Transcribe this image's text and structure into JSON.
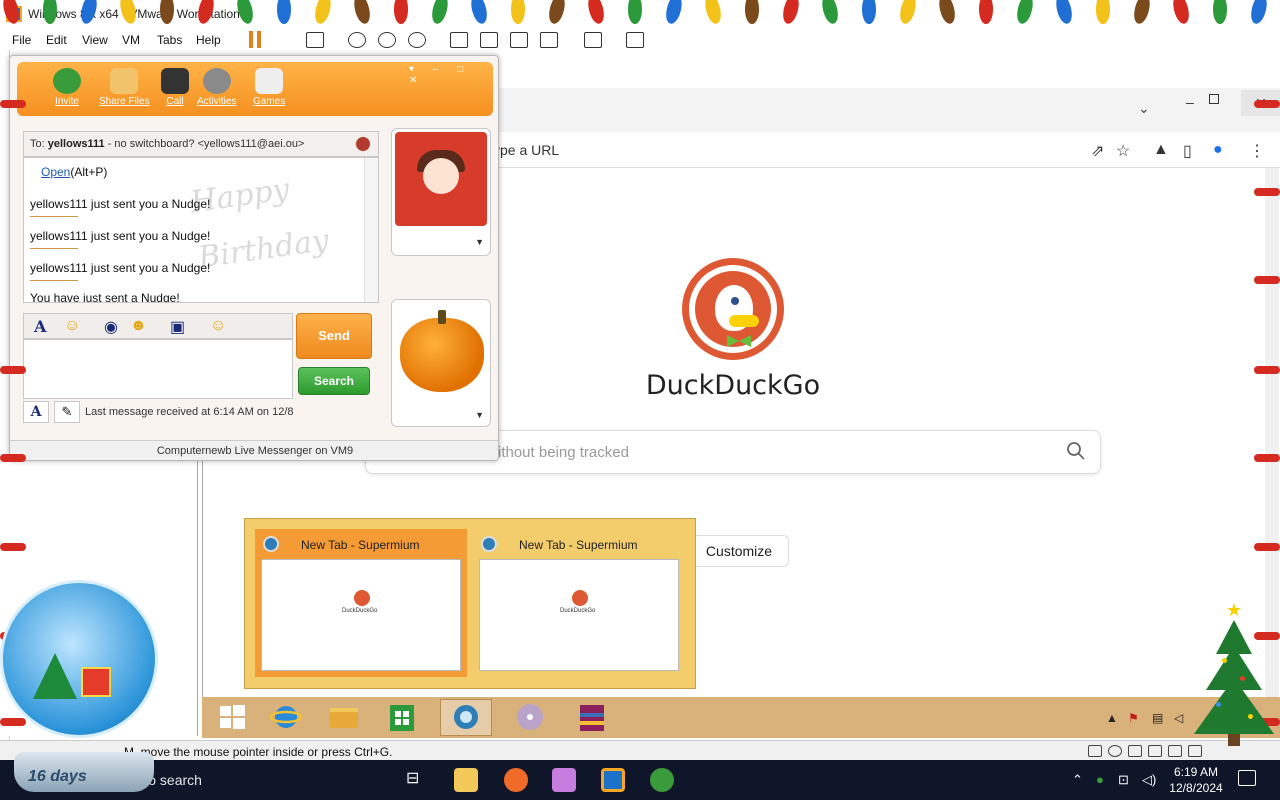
{
  "vmware": {
    "title": "Windows 8.x x64 - VMware Workstation",
    "menu": [
      "File",
      "Edit",
      "View",
      "VM",
      "Tabs",
      "Help"
    ],
    "status_text": "M, move the mouse pointer inside or press Ctrl+G."
  },
  "browser": {
    "address_placeholder": "ype a URL",
    "brand": "DuckDuckGo",
    "search_placeholder": "ithout being tracked",
    "customize_label": "Customize",
    "close_glyph": "✕",
    "min_glyph": "–",
    "dropdown_glyph": "⌄"
  },
  "taskbar_preview": {
    "items": [
      {
        "title": "New Tab - Supermium",
        "thumb_brand": "DuckDuckGo",
        "active": true
      },
      {
        "title": "New Tab - Supermium",
        "thumb_brand": "DuckDuckGo",
        "active": false
      }
    ]
  },
  "messenger": {
    "toolbar": [
      {
        "label": "Invite",
        "icon": "invite-icon",
        "color": "#3a9b3a"
      },
      {
        "label": "Share Files",
        "icon": "folder-icon",
        "color": "#f1c36a"
      },
      {
        "label": "Call",
        "icon": "phone-icon",
        "color": "#333333"
      },
      {
        "label": "Activities",
        "icon": "activities-icon",
        "color": "#8a8a8a"
      },
      {
        "label": "Games",
        "icon": "games-icon",
        "color": "#eeeeee"
      }
    ],
    "to_label": "To:",
    "to_name": "yellows111",
    "to_detail": "- no switchboard? <yellows111@aei.ou>",
    "open_link": "Open",
    "open_shortcut": "(Alt+P)",
    "messages": [
      "yellows111 just sent you a Nudge!",
      "yellows111 just sent you a Nudge!",
      "yellows111 just sent you a Nudge!",
      "You have just sent a Nudge!"
    ],
    "send_label": "Send",
    "search_label": "Search",
    "last_message": "Last message received at 6:14 AM on 12/8",
    "footer": "Computernewb Live Messenger on VM9",
    "format_letter": "A"
  },
  "host": {
    "search_text": "re to search",
    "clock_time": "6:19 AM",
    "clock_date": "12/8/2024",
    "globe_text": "16 days"
  },
  "colors": {
    "messenger_orange": "#f59020",
    "ddg_orange": "#de5833",
    "guest_taskbar": "#d9b17a",
    "host_taskbar": "#10162a"
  }
}
